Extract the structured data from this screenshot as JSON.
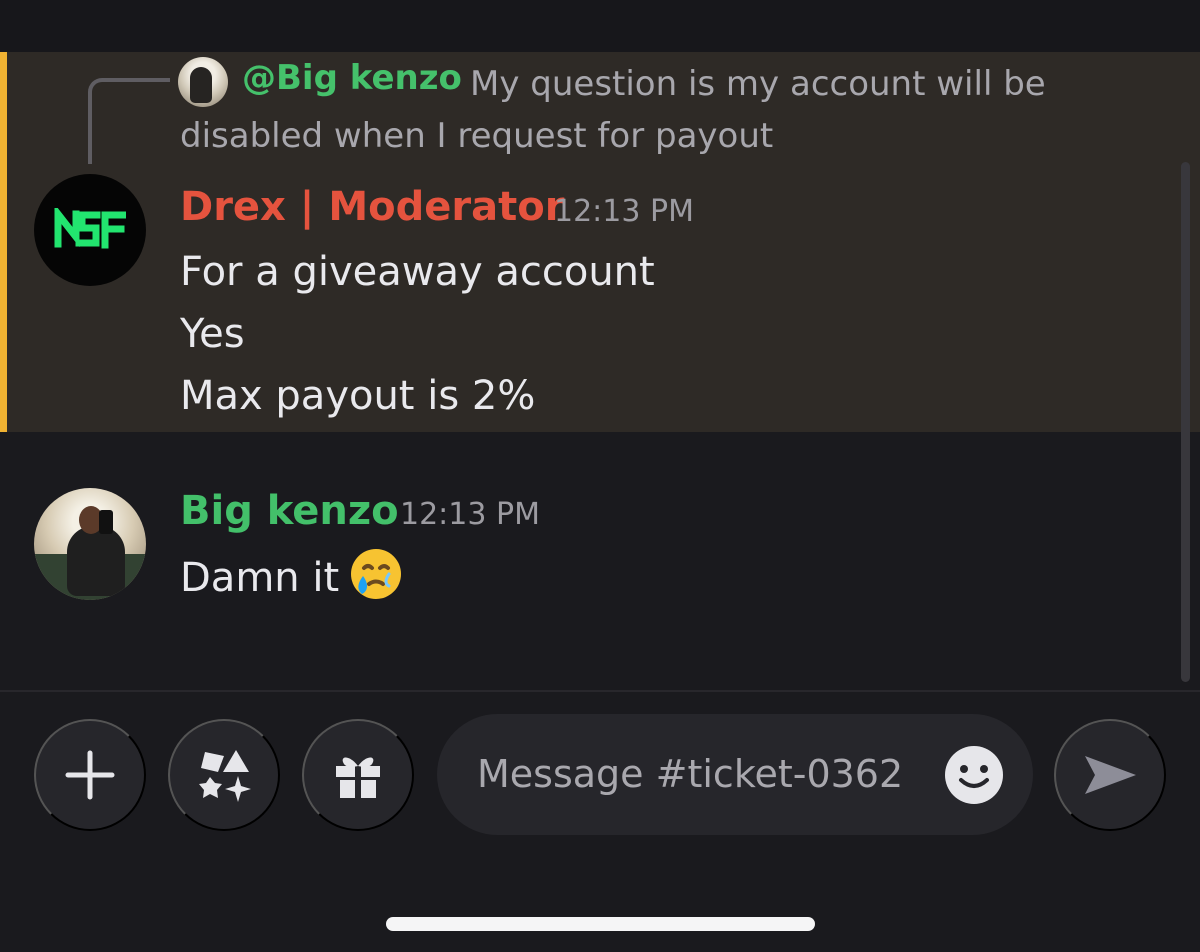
{
  "reply_preview": {
    "author": "@Big kenzo",
    "text": "My question is my account will be disabled when I request for payout"
  },
  "messages": [
    {
      "author": "Drex | Moderator",
      "timestamp": "12:13 PM",
      "lines": [
        "For a giveaway account",
        "Yes",
        "Max payout is 2%"
      ],
      "author_color": "#e5533e",
      "avatar_text": "NSF"
    },
    {
      "author": "Big kenzo",
      "timestamp": "12:13 PM",
      "text": "Damn it",
      "author_color": "#43c06a",
      "emoji": "face-holding-back-tears"
    }
  ],
  "composer": {
    "placeholder": "Message #ticket-0362"
  },
  "icons": {
    "add": "plus-icon",
    "apps": "apps-icon",
    "gift": "gift-icon",
    "emoji": "smile-icon",
    "send": "send-icon"
  },
  "colors": {
    "background": "#1a1a1e",
    "highlight": "#2e2a26",
    "highlight_bar": "#f0b232",
    "surface": "#26262b"
  }
}
